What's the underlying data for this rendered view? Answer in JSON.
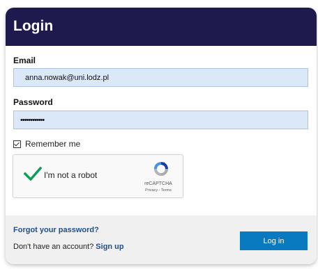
{
  "header": {
    "title": "Login"
  },
  "form": {
    "email_label": "Email",
    "email_value": "anna.nowak@uni.lodz.pl",
    "password_label": "Password",
    "password_value": "••••••••••••",
    "remember_label": "Remember me",
    "remember_checked": true
  },
  "captcha": {
    "label": "I'm not a robot",
    "brand": "reCAPTCHA",
    "privacy": "Privacy",
    "separator": " - ",
    "terms": "Terms",
    "check_icon": "checkmark-icon",
    "logo_icon": "recaptcha-logo-icon"
  },
  "footer": {
    "forgot_label": "Forgot your password?",
    "no_account_text": "Don't have an account?",
    "signup_label": "Sign up",
    "login_label": "Log in"
  },
  "colors": {
    "header_bg": "#1e1a4d",
    "field_bg": "#dbe8f8",
    "link": "#1f4f8b",
    "button_bg": "#0a7ac0",
    "check_green": "#0f9d58"
  }
}
